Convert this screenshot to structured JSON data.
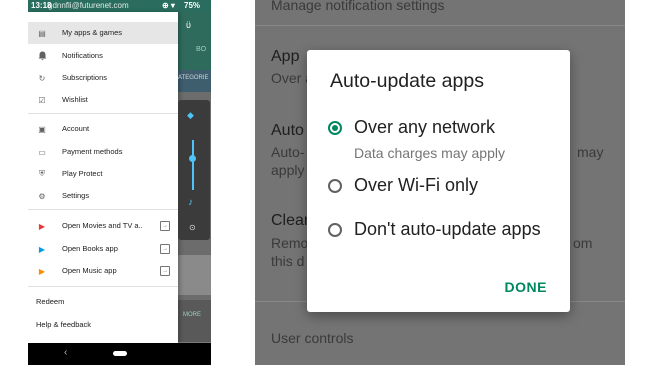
{
  "left_phone": {
    "status_bar": {
      "time": "13:18",
      "email": "gdnnfli@futurenet.com",
      "icons": "⊕ ▾",
      "battery": "75%"
    },
    "search_hint": "ϋ",
    "tabs_partial": "BO",
    "categories_partial": "ATEGORIE",
    "more_label": "MORE",
    "drawer": {
      "items": [
        {
          "label": "My apps & games",
          "icon": "apps-icon",
          "glyph": "▤"
        },
        {
          "label": "Notifications",
          "icon": "bell-icon",
          "glyph": "🔔"
        },
        {
          "label": "Subscriptions",
          "icon": "refresh-icon",
          "glyph": "↻"
        },
        {
          "label": "Wishlist",
          "icon": "bookmark-icon",
          "glyph": "☑"
        },
        {
          "label": "Account",
          "icon": "account-icon",
          "glyph": "▣"
        },
        {
          "label": "Payment methods",
          "icon": "card-icon",
          "glyph": "▭"
        },
        {
          "label": "Play Protect",
          "icon": "shield-icon",
          "glyph": "⛨"
        },
        {
          "label": "Settings",
          "icon": "gear-icon",
          "glyph": "⚙"
        },
        {
          "label": "Open Movies and TV a..",
          "icon": "movies-icon",
          "glyph": "▶"
        },
        {
          "label": "Open Books app",
          "icon": "books-icon",
          "glyph": "▶"
        },
        {
          "label": "Open Music app",
          "icon": "music-icon",
          "glyph": "▶"
        }
      ],
      "plain_items": [
        "Redeem",
        "Help & feedback"
      ]
    }
  },
  "right_phone": {
    "bg": {
      "top": "Manage notification settings",
      "app_label": "App",
      "app_sub": "Over a",
      "auto_label": "Auto",
      "auto_sub1": "Auto-",
      "auto_sub2": "apply",
      "auto_right": "may",
      "clear_label": "Clear",
      "clear_sub1": "Remo",
      "clear_sub2": "this d",
      "clear_right": "om",
      "user_controls": "User controls"
    },
    "dialog": {
      "title": "Auto-update apps",
      "options": [
        {
          "label": "Over any network",
          "selected": true
        },
        {
          "label": "Over Wi-Fi only",
          "selected": false
        },
        {
          "label": "Don't auto-update apps",
          "selected": false
        }
      ],
      "option1_sub": "Data charges may apply",
      "done": "DONE"
    }
  },
  "colors": {
    "accent": "#01875f",
    "status_teal": "#2a6d5e"
  }
}
